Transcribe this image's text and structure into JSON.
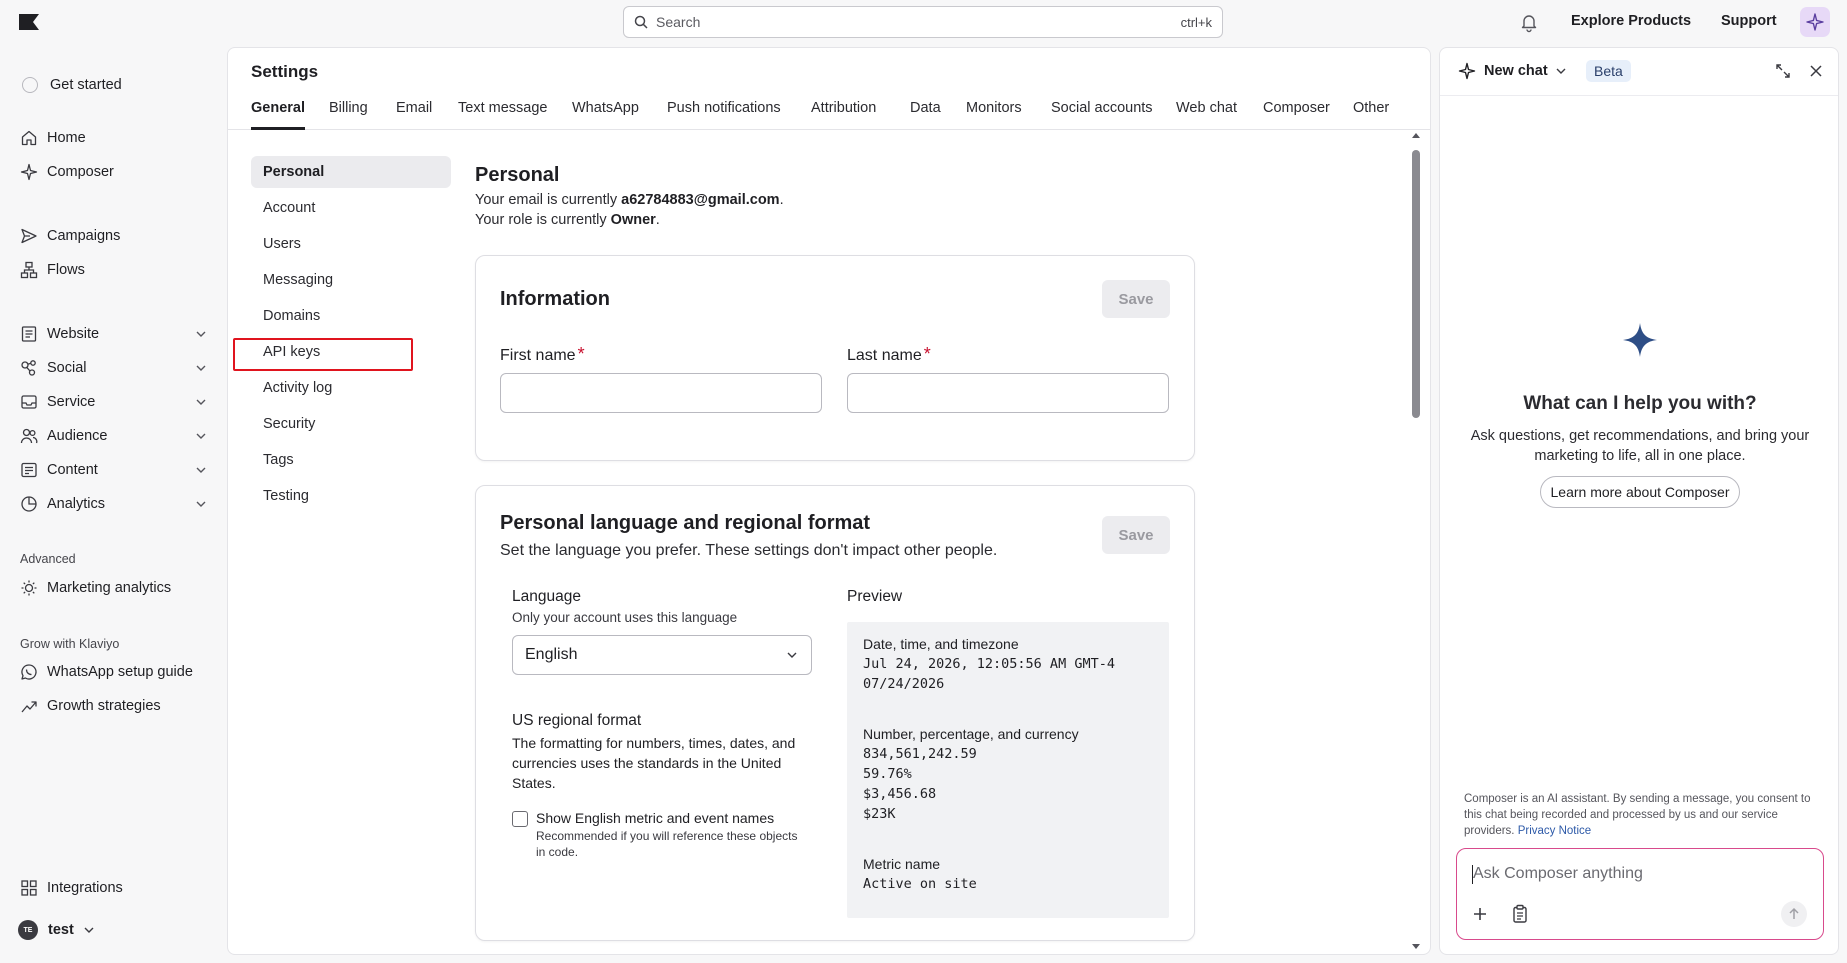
{
  "topbar": {
    "search_placeholder": "Search",
    "search_shortcut": "ctrl+k",
    "explore_products": "Explore Products",
    "support": "Support"
  },
  "leftnav": {
    "get_started": "Get started",
    "home": "Home",
    "composer": "Composer",
    "campaigns": "Campaigns",
    "flows": "Flows",
    "website": "Website",
    "social": "Social",
    "service": "Service",
    "audience": "Audience",
    "content": "Content",
    "analytics": "Analytics",
    "advanced_heading": "Advanced",
    "marketing_analytics": "Marketing analytics",
    "grow_heading": "Grow with Klaviyo",
    "whatsapp_guide": "WhatsApp setup guide",
    "growth_strategies": "Growth strategies",
    "integrations": "Integrations",
    "user_initials": "TE",
    "user_name": "test"
  },
  "settings": {
    "title": "Settings",
    "tabs": [
      "General",
      "Billing",
      "Email",
      "Text message",
      "WhatsApp",
      "Push notifications",
      "Attribution",
      "Data",
      "Monitors",
      "Social accounts",
      "Web chat",
      "Composer",
      "Other"
    ],
    "active_tab": "General",
    "subnav": [
      "Personal",
      "Account",
      "Users",
      "Messaging",
      "Domains",
      "API keys",
      "Activity log",
      "Security",
      "Tags",
      "Testing"
    ],
    "active_subnav": "Personal",
    "highlighted_subnav": "API keys"
  },
  "personal": {
    "heading": "Personal",
    "email_prefix": "Your email is currently ",
    "email": "a62784883@gmail.com",
    "email_suffix": ".",
    "role_prefix": "Your role is currently ",
    "role": "Owner",
    "role_suffix": "."
  },
  "information": {
    "title": "Information",
    "save": "Save",
    "first_name_label": "First name",
    "last_name_label": "Last name",
    "required_mark": "*",
    "first_name_value": "",
    "last_name_value": ""
  },
  "language_card": {
    "title": "Personal language and regional format",
    "subtitle": "Set the language you prefer. These settings don't impact other people.",
    "save": "Save",
    "language_label": "Language",
    "language_help": "Only your account uses this language",
    "language_value": "English",
    "regional_label": "US regional format",
    "regional_desc": "The formatting for numbers, times, dates, and currencies uses the standards in the United States.",
    "checkbox_label": "Show English metric and event names",
    "checkbox_help": "Recommended if you will reference these objects in code.",
    "checkbox_checked": false,
    "preview_label": "Preview",
    "preview": {
      "datetime_label": "Date, time, and timezone",
      "datetime_1": "Jul 24, 2026, 12:05:56 AM GMT-4",
      "datetime_2": "07/24/2026",
      "number_label": "Number, percentage, and currency",
      "number": "834,561,242.59",
      "percent": "59.76%",
      "currency": "$3,456.68",
      "compact": "$23K",
      "metric_label": "Metric name",
      "metric_value": "Active on site"
    }
  },
  "chat": {
    "new_chat": "New chat",
    "beta": "Beta",
    "hero_title": "What can I help you with?",
    "hero_sub": "Ask questions, get recommendations, and bring your marketing to life, all in one place.",
    "learn_more": "Learn more about Composer",
    "disclaimer": "Composer is an AI assistant. By sending a message, you consent to this chat being recorded and processed by us and our service providers. ",
    "privacy_notice": "Privacy Notice",
    "input_placeholder": "Ask Composer anything"
  },
  "colors": {
    "accent_pink": "#d84a8c",
    "composer_star": "#2e4e86",
    "highlight_red": "#e0141e",
    "required_red": "#c8102e"
  }
}
